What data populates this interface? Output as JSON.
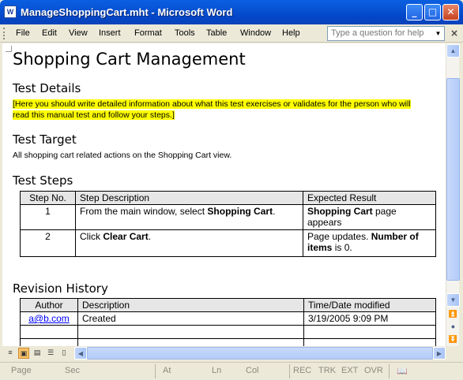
{
  "window": {
    "app_icon": "W",
    "title": "ManageShoppingCart.mht - Microsoft Word",
    "buttons": {
      "minimize_icon": "minimize-icon",
      "maximize_icon": "maximize-icon",
      "close_icon": "close-icon"
    }
  },
  "menu": {
    "items": [
      "File",
      "Edit",
      "View",
      "Insert",
      "Format",
      "Tools",
      "Table",
      "Window",
      "Help"
    ],
    "ask_placeholder": "Type a question for help",
    "doc_close": "×"
  },
  "document": {
    "title": "Shopping Cart Management",
    "test_details_heading": "Test Details",
    "test_details_line1": "[Here you should write detailed information about what this test exercises or validates for the person who will",
    "test_details_line2": "read this manual test and follow your steps.]",
    "test_target_heading": "Test Target",
    "test_target_text": "All shopping cart related actions on the Shopping Cart view.",
    "test_steps_heading": "Test Steps",
    "steps_table": {
      "headers": [
        "Step No.",
        "Step Description",
        "Expected Result"
      ],
      "rows": [
        {
          "step": "1",
          "desc_pre": "From the main window, select ",
          "desc_bold": "Shopping Cart",
          "desc_post": ".",
          "res_bold": "Shopping Cart",
          "res_post": " page appears"
        },
        {
          "step": "2",
          "desc_pre": "Click ",
          "desc_bold": "Clear Cart",
          "desc_post": ".",
          "res_pre": "Page updates. ",
          "res_bold": "Number of items",
          "res_post": " is 0."
        }
      ]
    },
    "revision_heading": "Revision History",
    "revision_table": {
      "headers": [
        "Author",
        "Description",
        "Time/Date modified"
      ],
      "rows": [
        {
          "author": "a@b.com",
          "description": "Created",
          "time": "3/19/2005 9:09 PM"
        }
      ]
    }
  },
  "statusbar": {
    "page": "Page",
    "sec": "Sec",
    "at": "At",
    "ln": "Ln",
    "col": "Col",
    "rec": "REC",
    "trk": "TRK",
    "ext": "EXT",
    "ovr": "OVR"
  }
}
